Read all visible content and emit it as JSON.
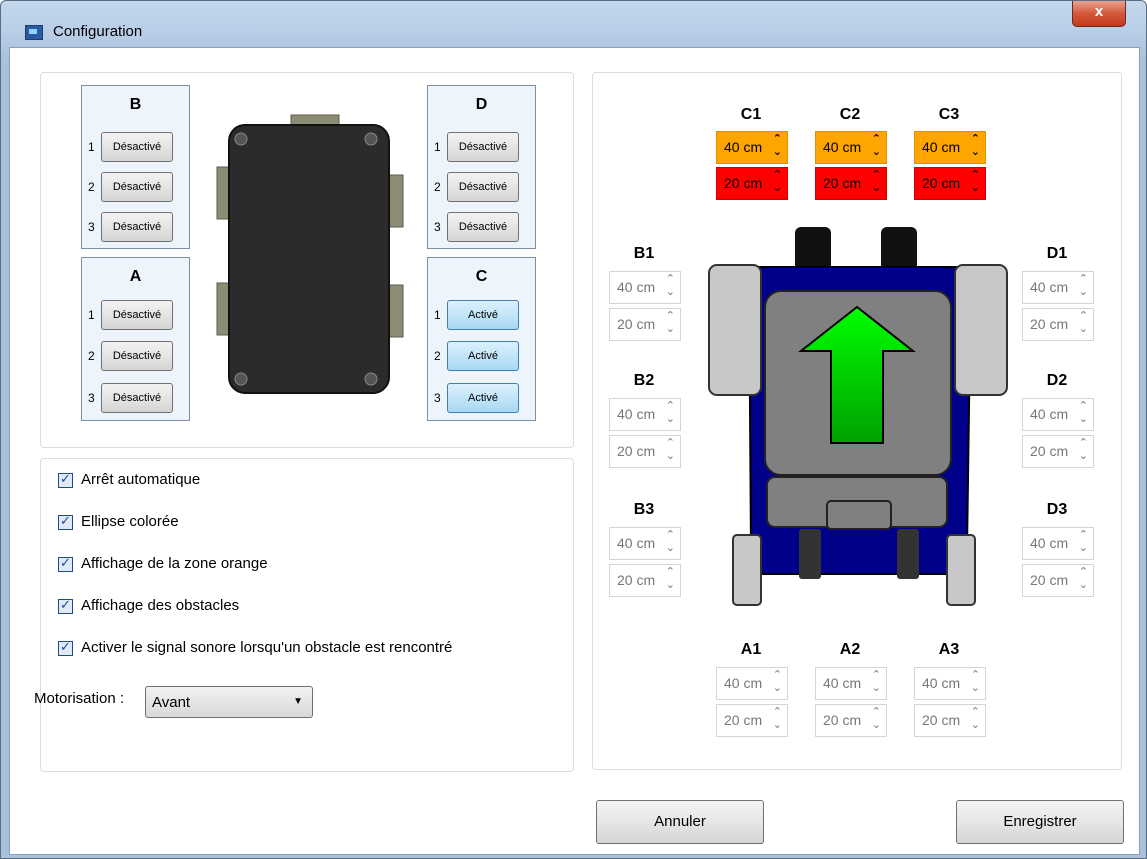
{
  "window": {
    "title": "Configuration",
    "close_label": "x"
  },
  "sensor_groups": {
    "B": {
      "label": "B",
      "slots": [
        {
          "num": "1",
          "state": "Désactivé"
        },
        {
          "num": "2",
          "state": "Désactivé"
        },
        {
          "num": "3",
          "state": "Désactivé"
        }
      ]
    },
    "D": {
      "label": "D",
      "slots": [
        {
          "num": "1",
          "state": "Désactivé"
        },
        {
          "num": "2",
          "state": "Désactivé"
        },
        {
          "num": "3",
          "state": "Désactivé"
        }
      ]
    },
    "A": {
      "label": "A",
      "slots": [
        {
          "num": "1",
          "state": "Désactivé"
        },
        {
          "num": "2",
          "state": "Désactivé"
        },
        {
          "num": "3",
          "state": "Désactivé"
        }
      ]
    },
    "C": {
      "label": "C",
      "slots": [
        {
          "num": "1",
          "state": "Activé"
        },
        {
          "num": "2",
          "state": "Activé"
        },
        {
          "num": "3",
          "state": "Activé"
        }
      ]
    }
  },
  "options": {
    "auto_stop": {
      "label": "Arrêt automatique",
      "checked": true
    },
    "colored_ellipse": {
      "label": "Ellipse colorée",
      "checked": true
    },
    "orange_zone": {
      "label": "Affichage de la zone orange",
      "checked": true
    },
    "obstacles": {
      "label": "Affichage des obstacles",
      "checked": true
    },
    "sound_signal": {
      "label": "Activer le signal sonore lorsqu'un obstacle est rencontré",
      "checked": true
    }
  },
  "motorisation": {
    "label": "Motorisation :",
    "value": "Avant"
  },
  "zones": {
    "C1": {
      "label": "C1",
      "orange": "40 cm",
      "red": "20 cm"
    },
    "C2": {
      "label": "C2",
      "orange": "40 cm",
      "red": "20 cm"
    },
    "C3": {
      "label": "C3",
      "orange": "40 cm",
      "red": "20 cm"
    },
    "B1": {
      "label": "B1",
      "orange": "40 cm",
      "red": "20 cm"
    },
    "B2": {
      "label": "B2",
      "orange": "40 cm",
      "red": "20 cm"
    },
    "B3": {
      "label": "B3",
      "orange": "40 cm",
      "red": "20 cm"
    },
    "D1": {
      "label": "D1",
      "orange": "40 cm",
      "red": "20 cm"
    },
    "D2": {
      "label": "D2",
      "orange": "40 cm",
      "red": "20 cm"
    },
    "D3": {
      "label": "D3",
      "orange": "40 cm",
      "red": "20 cm"
    },
    "A1": {
      "label": "A1",
      "orange": "40 cm",
      "red": "20 cm"
    },
    "A2": {
      "label": "A2",
      "orange": "40 cm",
      "red": "20 cm"
    },
    "A3": {
      "label": "A3",
      "orange": "40 cm",
      "red": "20 cm"
    }
  },
  "buttons": {
    "cancel": "Annuler",
    "save": "Enregistrer"
  },
  "colors": {
    "orange_zone": "#ffa500",
    "red_zone": "#ff0000",
    "active_button": "#a7d8f3",
    "robot_body": "#00008b",
    "direction_arrow": "#00c000"
  }
}
